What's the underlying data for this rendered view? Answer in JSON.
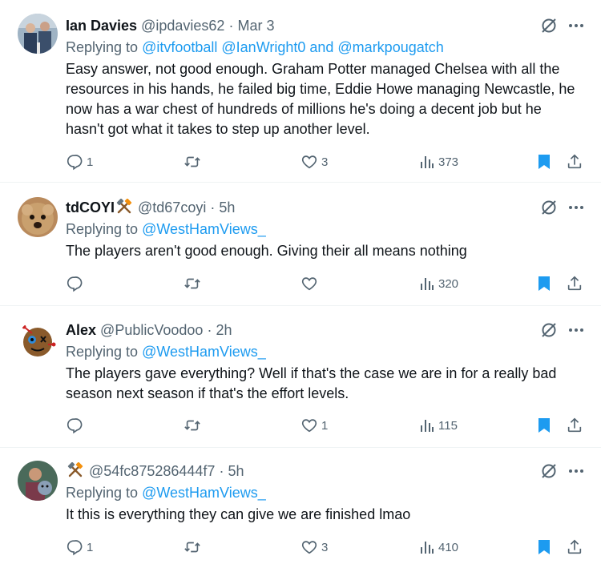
{
  "tweets": [
    {
      "name": "Ian Davies",
      "handle": "@ipdavies62",
      "dot": "·",
      "time": "Mar 3",
      "replying_prefix": "Replying to",
      "replying_to": "@itvfootball @IanWright0 and @markpougatch",
      "text": "Easy answer, not good enough. Graham Potter managed Chelsea with all the resources in his hands, he failed big time, Eddie Howe managing Newcastle, he now has a war chest of hundreds of millions  he's doing a decent job but he hasn't got what it takes to step up another level.",
      "replies": "1",
      "retweets": "",
      "likes": "3",
      "views": "373",
      "bookmarked": true
    },
    {
      "name": "tdCOYI",
      "handle": "@td67coyi",
      "dot": "·",
      "time": "5h",
      "replying_prefix": "Replying to",
      "replying_to": "@WestHamViews_",
      "text": "The players aren't good enough. Giving their all means nothing",
      "replies": "",
      "retweets": "",
      "likes": "",
      "views": "320",
      "bookmarked": true
    },
    {
      "name": "Alex",
      "handle": "@PublicVoodoo",
      "dot": "·",
      "time": "2h",
      "replying_prefix": "Replying to",
      "replying_to": "@WestHamViews_",
      "text": "The players gave everything? Well if that's the case we are in for a really bad season next season if that's the effort levels.",
      "replies": "",
      "retweets": "",
      "likes": "1",
      "views": "115",
      "bookmarked": true
    },
    {
      "name": "",
      "handle": "@54fc875286444f7",
      "dot": "·",
      "time": "5h",
      "replying_prefix": "Replying to",
      "replying_to": "@WestHamViews_",
      "text": "It this is everything they can give we are finished lmao",
      "replies": "1",
      "retweets": "",
      "likes": "3",
      "views": "410",
      "bookmarked": true
    }
  ],
  "icons": {
    "reply": "reply-icon",
    "retweet": "retweet-icon",
    "like": "heart-icon",
    "views": "views-icon",
    "bookmark": "bookmark-icon",
    "share": "share-icon",
    "grok": "grok-icon",
    "more": "more-icon",
    "hammers": "hammers-emoji"
  },
  "colors": {
    "link": "#1d9bf0",
    "secondary": "#536471",
    "text": "#0f1419",
    "divider": "#eff3f4",
    "hammer_orange": "#f4900c"
  }
}
